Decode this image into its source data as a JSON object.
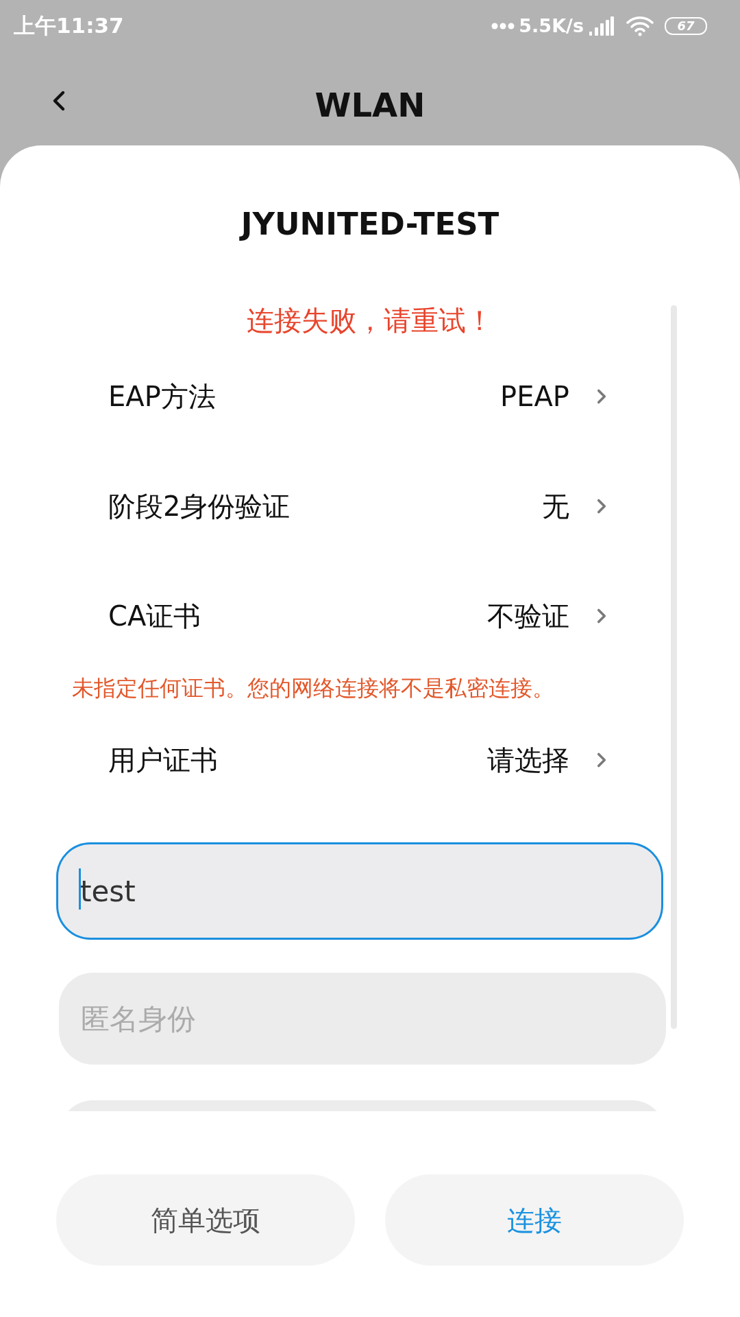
{
  "status_bar": {
    "time": "上午11:37",
    "network_speed": "5.5K/s",
    "battery": "67"
  },
  "header": {
    "title": "WLAN"
  },
  "dialog": {
    "title": "JYUNITED-TEST",
    "error": "连接失败，请重试！",
    "settings": [
      {
        "kind": "select",
        "label": "EAP方法",
        "value": "PEAP"
      },
      {
        "kind": "select",
        "label": "阶段2身份验证",
        "value": "无"
      },
      {
        "kind": "select",
        "label": "CA证书",
        "value": "不验证"
      },
      {
        "kind": "warning",
        "text": "未指定任何证书。您的网络连接将不是私密连接。"
      },
      {
        "kind": "select",
        "label": "用户证书",
        "value": "请选择"
      }
    ],
    "fields": [
      {
        "value": "test",
        "focused": true
      },
      {
        "placeholder": "匿名身份",
        "focused": false
      },
      {
        "focused": false
      }
    ],
    "buttons": [
      {
        "label": "简单选项",
        "primary": false
      },
      {
        "label": "连接",
        "primary": true
      }
    ]
  }
}
